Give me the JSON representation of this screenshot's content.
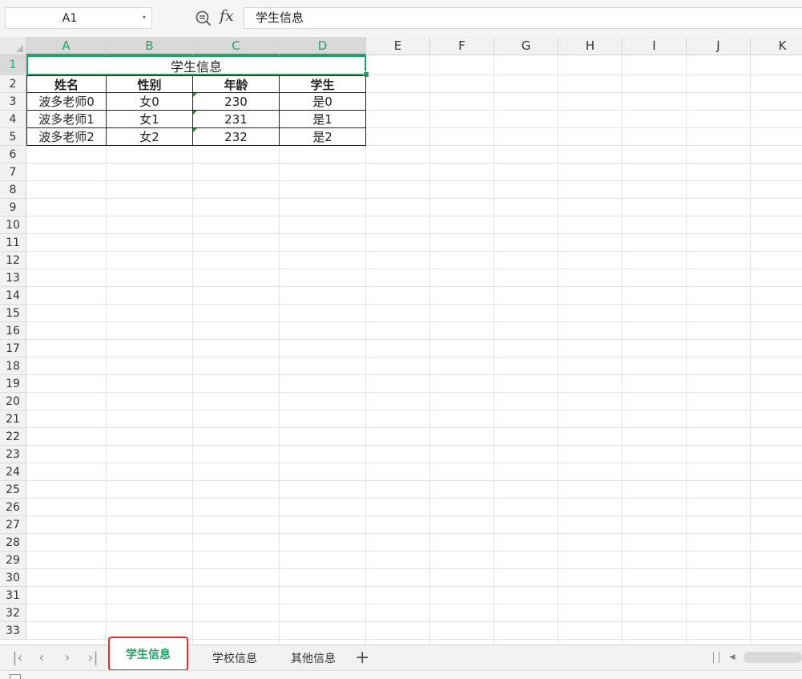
{
  "formula_bar": {
    "name_box": "A1",
    "dropdown_glyph": "▾",
    "formula_value": "学生信息",
    "fx_label": "fx"
  },
  "columns": [
    "A",
    "B",
    "C",
    "D",
    "E",
    "F",
    "G",
    "H",
    "I",
    "J",
    "K"
  ],
  "rows": [
    "1",
    "2",
    "3",
    "4",
    "5",
    "6",
    "7",
    "8",
    "9",
    "10",
    "11",
    "12",
    "13",
    "14",
    "15",
    "16",
    "17",
    "18",
    "19",
    "20",
    "21",
    "22",
    "23",
    "24",
    "25",
    "26",
    "27",
    "28",
    "29",
    "30",
    "31",
    "32",
    "33"
  ],
  "sheet": {
    "title": "学生信息",
    "headers": [
      "姓名",
      "性别",
      "年龄",
      "学生"
    ],
    "data": [
      [
        "波多老师0",
        "女0",
        "230",
        "是0"
      ],
      [
        "波多老师1",
        "女1",
        "231",
        "是1"
      ],
      [
        "波多老师2",
        "女2",
        "232",
        "是2"
      ]
    ]
  },
  "tabs": {
    "nav": [
      "|‹",
      "‹",
      "›",
      "›|"
    ],
    "items": [
      {
        "label": "学生信息",
        "active": true
      },
      {
        "label": "学校信息",
        "active": false
      },
      {
        "label": "其他信息",
        "active": false
      }
    ],
    "add_label": "+"
  },
  "colors": {
    "accent": "#21a366",
    "highlight_box": "#e0312a"
  },
  "icons": {
    "zoom": "zoom-formula-icon",
    "fx": "fx-icon"
  }
}
